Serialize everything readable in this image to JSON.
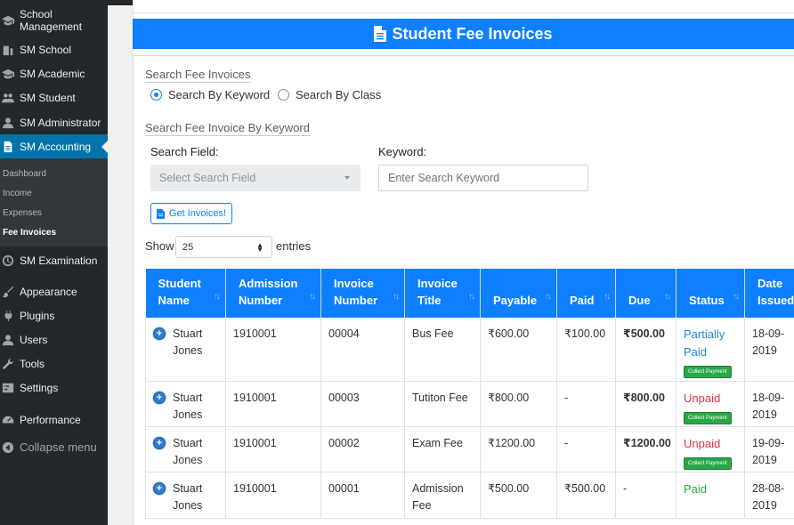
{
  "sidebar": {
    "items": [
      {
        "label": "School Management",
        "icon": "graduation-cap-icon"
      },
      {
        "label": "SM School",
        "icon": "building-icon"
      },
      {
        "label": "SM Academic",
        "icon": "graduation-cap-icon"
      },
      {
        "label": "SM Student",
        "icon": "users-icon"
      },
      {
        "label": "SM Administrator",
        "icon": "user-icon"
      },
      {
        "label": "SM Accounting",
        "icon": "document-icon",
        "active": true
      },
      {
        "label": "SM Examination",
        "icon": "clock-icon"
      },
      {
        "label": "Appearance",
        "icon": "paintbrush-icon"
      },
      {
        "label": "Plugins",
        "icon": "plug-icon"
      },
      {
        "label": "Users",
        "icon": "user-icon"
      },
      {
        "label": "Tools",
        "icon": "wrench-icon"
      },
      {
        "label": "Settings",
        "icon": "sliders-icon"
      },
      {
        "label": "Performance",
        "icon": "gauge-icon"
      },
      {
        "label": "Collapse menu",
        "icon": "collapse-icon"
      }
    ],
    "submenu": [
      {
        "label": "Dashboard"
      },
      {
        "label": "Income"
      },
      {
        "label": "Expenses"
      },
      {
        "label": "Fee Invoices",
        "current": true
      }
    ]
  },
  "header": {
    "title": "Student Fee Invoices"
  },
  "search": {
    "legend": "Search Fee Invoices",
    "option_keyword": "Search By Keyword",
    "option_class": "Search By Class",
    "keyword_legend": "Search Fee Invoice By Keyword",
    "field_label": "Search Field:",
    "field_placeholder": "Select Search Field",
    "keyword_label": "Keyword:",
    "keyword_placeholder": "Enter Search Keyword",
    "button_label": "Get Invoices!"
  },
  "entries": {
    "show": "Show",
    "value": "25",
    "suffix": "entries"
  },
  "table": {
    "columns": [
      [
        "Student",
        "Name"
      ],
      [
        "Admission",
        "Number"
      ],
      [
        "Invoice",
        "Number"
      ],
      [
        "Invoice",
        "Title"
      ],
      [
        "Payable"
      ],
      [
        "Paid"
      ],
      [
        "Due"
      ],
      [
        "Status"
      ],
      [
        "Date",
        "Issued"
      ]
    ],
    "collect_label": "Collect Payment",
    "rows": [
      {
        "name": [
          "Stuart",
          "Jones"
        ],
        "admission": "1910001",
        "invoice": "00004",
        "title": [
          "Bus Fee"
        ],
        "payable": "₹600.00",
        "paid": "₹100.00",
        "due": "₹500.00",
        "status": [
          "Partially",
          "Paid"
        ],
        "status_type": "partial",
        "collect": true,
        "date": [
          "18-09-",
          "2019"
        ]
      },
      {
        "name": [
          "Stuart",
          "Jones"
        ],
        "admission": "1910001",
        "invoice": "00003",
        "title": [
          "Tutiton Fee"
        ],
        "payable": "₹800.00",
        "paid": "-",
        "due": "₹800.00",
        "status": [
          "Unpaid"
        ],
        "status_type": "unpaid",
        "collect": true,
        "date": [
          "18-09-",
          "2019"
        ]
      },
      {
        "name": [
          "Stuart",
          "Jones"
        ],
        "admission": "1910001",
        "invoice": "00002",
        "title": [
          "Exam Fee"
        ],
        "payable": "₹1200.00",
        "paid": "-",
        "due": "₹1200.00",
        "status": [
          "Unpaid"
        ],
        "status_type": "unpaid",
        "collect": true,
        "date": [
          "19-09-",
          "2019"
        ]
      },
      {
        "name": [
          "Stuart",
          "Jones"
        ],
        "admission": "1910001",
        "invoice": "00001",
        "title": [
          "Admission",
          "Fee"
        ],
        "payable": "₹500.00",
        "paid": "₹500.00",
        "due": "-",
        "status": [
          "Paid"
        ],
        "status_type": "paid",
        "collect": false,
        "date": [
          "28-08-",
          "2019"
        ]
      }
    ]
  }
}
